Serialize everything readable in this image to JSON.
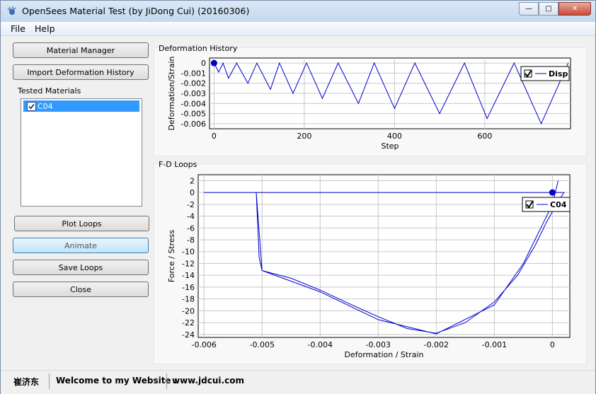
{
  "window": {
    "title": "OpenSees Material Test (by JiDong Cui) (20160306)"
  },
  "menu": [
    "File",
    "Help"
  ],
  "buttons": {
    "material_manager": "Material Manager",
    "import_deformation": "Import Deformation History",
    "plot_loops": "Plot Loops",
    "animate": "Animate",
    "save_loops": "Save Loops",
    "close": "Close"
  },
  "tested_materials": {
    "label": "Tested Materials",
    "items": [
      {
        "name": "C04",
        "checked": true
      }
    ]
  },
  "deformation_chart": {
    "title": "Deformation History",
    "xlabel": "Step",
    "ylabel": "Deformation/Strain",
    "xticks": [
      "0",
      "200",
      "400",
      "600"
    ],
    "yticks": [
      "0",
      "-0.001",
      "-0.002",
      "-0.003",
      "-0.004",
      "-0.005",
      "-0.006"
    ],
    "legend": "Disp"
  },
  "fd_chart": {
    "title": "F-D Loops",
    "xlabel": "Deformation / Strain",
    "ylabel": "Force  /  Stress",
    "xticks": [
      "-0.006",
      "-0.005",
      "-0.004",
      "-0.003",
      "-0.002",
      "-0.001",
      "0"
    ],
    "yticks": [
      "2",
      "0",
      "-2",
      "-4",
      "-6",
      "-8",
      "-10",
      "-12",
      "-14",
      "-16",
      "-18",
      "-20",
      "-22",
      "-24"
    ],
    "legend": "C04"
  },
  "statusbar": {
    "name": "崔济东",
    "welcome": "Welcome to my Website :",
    "url": "www.jdcui.com"
  },
  "chart_data": [
    {
      "type": "line",
      "title": "Deformation History",
      "xlabel": "Step",
      "ylabel": "Deformation/Strain",
      "xlim": [
        -10,
        790
      ],
      "ylim": [
        -0.0065,
        0.0005
      ],
      "series": [
        {
          "name": "Disp",
          "color": "#0000cc",
          "x": [
            0,
            10,
            20,
            32,
            50,
            75,
            95,
            125,
            145,
            175,
            205,
            240,
            275,
            320,
            355,
            400,
            445,
            500,
            555,
            605,
            665,
            725,
            785
          ],
          "y": [
            0,
            -0.0009,
            0,
            -0.0015,
            0,
            -0.002,
            0,
            -0.0026,
            0,
            -0.003,
            0,
            -0.0035,
            0,
            -0.004,
            0,
            -0.0045,
            0,
            -0.005,
            0,
            -0.0055,
            0,
            -0.006,
            0
          ]
        }
      ]
    },
    {
      "type": "line",
      "title": "F-D Loops",
      "xlabel": "Deformation / Strain",
      "ylabel": "Force  /  Stress",
      "xlim": [
        -0.0061,
        0.0003
      ],
      "ylim": [
        -24.5,
        3
      ],
      "series": [
        {
          "name": "C04",
          "color": "#0000cc",
          "x": [
            -0.006,
            0.0002,
            0.0001,
            -0.0001,
            -0.0003,
            -0.0006,
            -0.001,
            -0.0015,
            -0.002,
            -0.0025,
            -0.003,
            -0.0035,
            -0.004,
            -0.0045,
            -0.005,
            -0.0051,
            -0.00505,
            -0.005,
            -0.004,
            -0.003,
            -0.002,
            -0.001,
            -0.0005,
            0,
            0.0001
          ],
          "y": [
            0,
            0,
            -1.5,
            -5,
            -9,
            -14,
            -18.5,
            -22,
            -23.8,
            -23,
            -21,
            -18.8,
            -16.5,
            -14.5,
            -13.2,
            0,
            -11,
            -13.2,
            -16.8,
            -21.5,
            -23.9,
            -19,
            -12,
            -2,
            2
          ]
        }
      ]
    }
  ]
}
